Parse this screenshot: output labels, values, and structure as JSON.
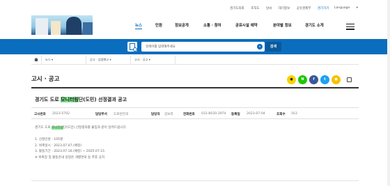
{
  "utility": {
    "links": [
      "경기도의회",
      "조직도",
      "날씨",
      "대기정보",
      "공유경제부"
    ],
    "gg_link": "경기가기",
    "language": "Language"
  },
  "nav": {
    "items": [
      "뉴스",
      "민원",
      "정보공개",
      "소통 · 참여",
      "공유시설 예약",
      "분야별 정보",
      "경기도 소개"
    ],
    "active": "뉴스"
  },
  "search": {
    "placeholder": "검색어를 입력해주세요",
    "button": "검색"
  },
  "breadcrumb": {
    "level1": "뉴스",
    "level2": "공고 · 입법예고",
    "level3": "고시 · 공고"
  },
  "page_title": "고시 · 공고",
  "share": {
    "icons": [
      {
        "name": "kakaotalk",
        "label": "●",
        "color": "#f5d400"
      },
      {
        "name": "naver",
        "label": "N",
        "color": "#1ec800"
      },
      {
        "name": "facebook",
        "label": "f",
        "color": "#3b5998"
      },
      {
        "name": "twitter",
        "label": "t",
        "color": "#1da1f2"
      },
      {
        "name": "kakaostory",
        "label": "●",
        "color": "#f5c200"
      }
    ]
  },
  "article": {
    "title_pre": "경기도 도로 ",
    "title_hl": "모니터링",
    "title_post": "단(도민) 선정결과 공고",
    "meta": {
      "no_label": "고시번호",
      "no_value": "2023-5702",
      "dept_label": "담당부서",
      "dept_value": "도로안전과",
      "person_label": "담당자",
      "person_value": "김보라",
      "tel_label": "전화번호",
      "tel_value": "031-8030-3974",
      "date_label": "등록일",
      "date_value": "2023-07-04",
      "views_label": "조회수",
      "views_value": "163"
    },
    "intro_pre": "경기도 도로 ",
    "intro_hl": "모니터링",
    "intro_post": "단(도민) 선정결과를 붙임과 같이 알려드립니다.",
    "lines": [
      "1. 선정인원 : 105명",
      "2. 위촉일시 : 2023.07.07.(예정)",
      "3. 활동기간 : 2023.07.16.(예정) ~ 2025.07.15",
      "※ 위촉장 및 활동안내 일정은 개별연락 등 추후 공지"
    ]
  }
}
